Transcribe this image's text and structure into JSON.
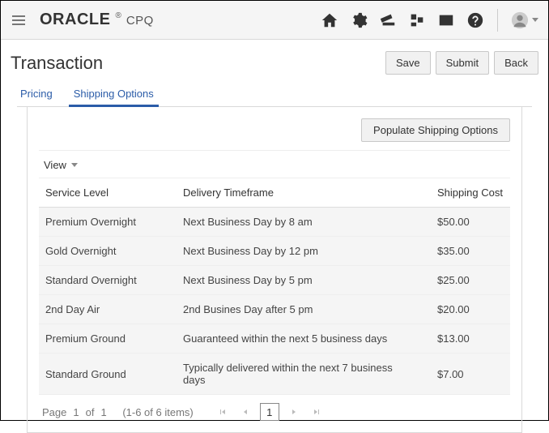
{
  "brand": {
    "main": "ORACLE",
    "reg": "®",
    "sub": "CPQ"
  },
  "page": {
    "title": "Transaction"
  },
  "buttons": {
    "save": "Save",
    "submit": "Submit",
    "back": "Back",
    "populate": "Populate Shipping Options"
  },
  "tabs": [
    {
      "label": "Pricing",
      "active": false
    },
    {
      "label": "Shipping Options",
      "active": true
    }
  ],
  "toolbar": {
    "view_label": "View"
  },
  "table": {
    "columns": {
      "service": "Service Level",
      "delivery": "Delivery Timeframe",
      "cost": "Shipping Cost"
    },
    "rows": [
      {
        "service": "Premium Overnight",
        "delivery": "Next Business Day by 8 am",
        "cost": "$50.00"
      },
      {
        "service": "Gold Overnight",
        "delivery": "Next Business Day by 12 pm",
        "cost": "$35.00"
      },
      {
        "service": "Standard Overnight",
        "delivery": "Next Business Day by 5 pm",
        "cost": "$25.00"
      },
      {
        "service": "2nd Day Air",
        "delivery": "2nd Busines Day after 5 pm",
        "cost": "$20.00"
      },
      {
        "service": "Premium Ground",
        "delivery": "Guaranteed within the next 5 business days",
        "cost": "$13.00"
      },
      {
        "service": "Standard Ground",
        "delivery": "Typically delivered within the next 7 business days",
        "cost": "$7.00"
      }
    ]
  },
  "pager": {
    "prefix": "Page",
    "current": "1",
    "of_label": "of",
    "total": "1",
    "range": "(1-6 of 6 items)",
    "page_box": "1"
  }
}
